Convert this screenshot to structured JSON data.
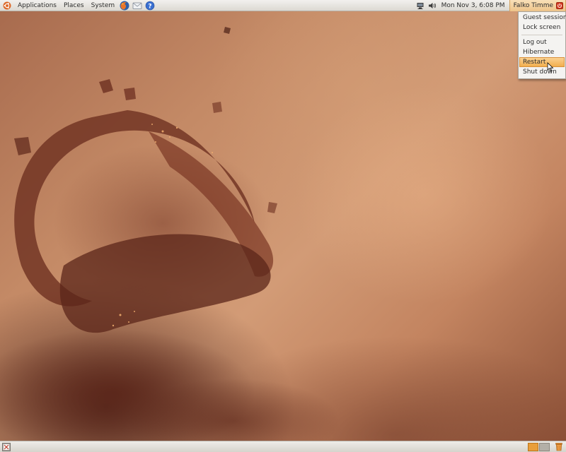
{
  "top_panel": {
    "menus": [
      {
        "label": "Applications"
      },
      {
        "label": "Places"
      },
      {
        "label": "System"
      }
    ],
    "launchers": [
      "firefox-icon",
      "mail-icon",
      "help-icon"
    ],
    "tray": [
      "network-icon",
      "volume-icon"
    ],
    "clock": "Mon Nov  3,  6:08 PM",
    "user": "Falko Timme",
    "accent_color": "#eec48a"
  },
  "user_menu": {
    "items": [
      {
        "label": "Guest session"
      },
      {
        "label": "Lock screen"
      },
      {
        "label": "Log out"
      },
      {
        "label": "Hibernate"
      },
      {
        "label": "Restart",
        "active": true
      },
      {
        "label": "Shut down"
      }
    ],
    "highlight_color": "#f1ae4e"
  },
  "bottom_panel": {
    "workspaces": [
      {
        "active": true
      },
      {
        "active": false
      }
    ],
    "active_color": "#e99e3a"
  }
}
